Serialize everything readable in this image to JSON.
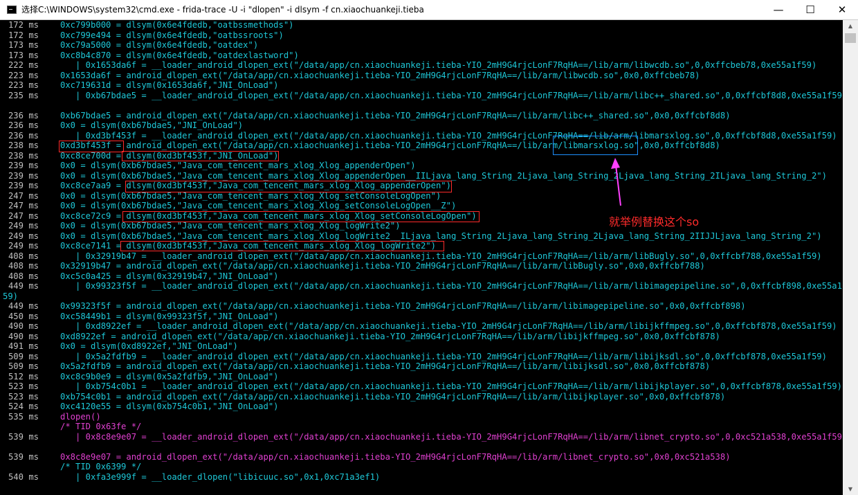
{
  "window": {
    "title": "选择C:\\WINDOWS\\system32\\cmd.exe - frida-trace  -U -i \"dlopen\" -i dlsym -f cn.xiaochuankeji.tieba",
    "minimize": "—",
    "maximize": "☐",
    "close": "✕"
  },
  "scrollbar": {
    "up": "▲",
    "down": "▼"
  },
  "annotation": {
    "text": "就举例替换这个so"
  },
  "lines": [
    {
      "t": "172 ms",
      "c": "0xc799b000 = dlsym(0x6e4fdedb,\"oatbssmethods\")",
      "color": "cyan"
    },
    {
      "t": "172 ms",
      "c": "0xc799e494 = dlsym(0x6e4fdedb,\"oatbssroots\")",
      "color": "cyan"
    },
    {
      "t": "173 ms",
      "c": "0xc79a5000 = dlsym(0x6e4fdedb,\"oatdex\")",
      "color": "cyan"
    },
    {
      "t": "173 ms",
      "c": "0xc8b4c870 = dlsym(0x6e4fdedb,\"oatdexlastword\")",
      "color": "cyan"
    },
    {
      "t": "222 ms",
      "c": "   | 0x1653da6f = __loader_android_dlopen_ext(\"/data/app/cn.xiaochuankeji.tieba-YIO_2mH9G4rjcLonF7RqHA==/lib/arm/libwcdb.so\",0,0xffcbeb78,0xe55a1f59)",
      "color": "cyan"
    },
    {
      "t": "223 ms",
      "c": "0x1653da6f = android_dlopen_ext(\"/data/app/cn.xiaochuankeji.tieba-YIO_2mH9G4rjcLonF7RqHA==/lib/arm/libwcdb.so\",0x0,0xffcbeb78)",
      "color": "cyan"
    },
    {
      "t": "223 ms",
      "c": "0xc719631d = dlsym(0x1653da6f,\"JNI_OnLoad\")",
      "color": "cyan"
    },
    {
      "t": "235 ms",
      "c": "   | 0xb67bdae5 = __loader_android_dlopen_ext(\"/data/app/cn.xiaochuankeji.tieba-YIO_2mH9G4rjcLonF7RqHA==/lib/arm/libc++_shared.so\",0,0xffcbf8d8,0xe55a1f59)",
      "color": "cyan"
    },
    {
      "t": "",
      "c": "",
      "color": "cyan"
    },
    {
      "t": "236 ms",
      "c": "0xb67bdae5 = android_dlopen_ext(\"/data/app/cn.xiaochuankeji.tieba-YIO_2mH9G4rjcLonF7RqHA==/lib/arm/libc++_shared.so\",0x0,0xffcbf8d8)",
      "color": "cyan"
    },
    {
      "t": "236 ms",
      "c": "0x0 = dlsym(0xb67bdae5,\"JNI_OnLoad\")",
      "color": "cyan"
    },
    {
      "t": "236 ms",
      "c": "   | 0xd3bf453f = __loader_android_dlopen_ext(\"/data/app/cn.xiaochuankeji.tieba-YIO_2mH9G4rjcLonF7RqHA==/lib/arm/libmarsxlog.so\",0,0xffcbf8d8,0xe55a1f59)",
      "color": "cyan"
    },
    {
      "t": "238 ms",
      "c": "0xd3bf453f = android_dlopen_ext(\"/data/app/cn.xiaochuankeji.tieba-YIO_2mH9G4rjcLonF7RqHA==/lib/arm/libmarsxlog.so\",0x0,0xffcbf8d8)",
      "color": "cyan"
    },
    {
      "t": "238 ms",
      "c": "0xc8ce700d = dlsym(0xd3bf453f,\"JNI_OnLoad\")",
      "color": "cyan"
    },
    {
      "t": "239 ms",
      "c": "0x0 = dlsym(0xb67bdae5,\"Java_com_tencent_mars_xlog_Xlog_appenderOpen\")",
      "color": "cyan"
    },
    {
      "t": "239 ms",
      "c": "0x0 = dlsym(0xb67bdae5,\"Java_com_tencent_mars_xlog_Xlog_appenderOpen__IILjava_lang_String_2Ljava_lang_String_2Ljava_lang_String_2ILjava_lang_String_2\")",
      "color": "cyan"
    },
    {
      "t": "239 ms",
      "c": "0xc8ce7aa9 = dlsym(0xd3bf453f,\"Java_com_tencent_mars_xlog_Xlog_appenderOpen\")",
      "color": "cyan"
    },
    {
      "t": "247 ms",
      "c": "0x0 = dlsym(0xb67bdae5,\"Java_com_tencent_mars_xlog_Xlog_setConsoleLogOpen\")",
      "color": "cyan"
    },
    {
      "t": "247 ms",
      "c": "0x0 = dlsym(0xb67bdae5,\"Java_com_tencent_mars_xlog_Xlog_setConsoleLogOpen__Z\")",
      "color": "cyan"
    },
    {
      "t": "247 ms",
      "c": "0xc8ce72c9 = dlsym(0xd3bf453f,\"Java_com_tencent_mars_xlog_Xlog_setConsoleLogOpen\")",
      "color": "cyan"
    },
    {
      "t": "249 ms",
      "c": "0x0 = dlsym(0xb67bdae5,\"Java_com_tencent_mars_xlog_Xlog_logWrite2\")",
      "color": "cyan"
    },
    {
      "t": "249 ms",
      "c": "0x0 = dlsym(0xb67bdae5,\"Java_com_tencent_mars_xlog_Xlog_logWrite2__ILjava_lang_String_2Ljava_lang_String_2Ljava_lang_String_2IIJJLjava_lang_String_2\")",
      "color": "cyan"
    },
    {
      "t": "249 ms",
      "c": "0xc8ce7141 = dlsym(0xd3bf453f,\"Java_com_tencent_mars_xlog_Xlog_logWrite2\")",
      "color": "cyan"
    },
    {
      "t": "408 ms",
      "c": "   | 0x32919b47 = __loader_android_dlopen_ext(\"/data/app/cn.xiaochuankeji.tieba-YIO_2mH9G4rjcLonF7RqHA==/lib/arm/libBugly.so\",0,0xffcbf788,0xe55a1f59)",
      "color": "cyan"
    },
    {
      "t": "408 ms",
      "c": "0x32919b47 = android_dlopen_ext(\"/data/app/cn.xiaochuankeji.tieba-YIO_2mH9G4rjcLonF7RqHA==/lib/arm/libBugly.so\",0x0,0xffcbf788)",
      "color": "cyan"
    },
    {
      "t": "408 ms",
      "c": "0xc5c0a425 = dlsym(0x32919b47,\"JNI_OnLoad\")",
      "color": "cyan"
    },
    {
      "t": "449 ms",
      "c": "   | 0x99323f5f = __loader_android_dlopen_ext(\"/data/app/cn.xiaochuankeji.tieba-YIO_2mH9G4rjcLonF7RqHA==/lib/arm/libimagepipeline.so\",0,0xffcbf898,0xe55a1f",
      "color": "cyan"
    },
    {
      "t": "59)",
      "c": "",
      "color": "cyan",
      "wrap": true
    },
    {
      "t": "449 ms",
      "c": "0x99323f5f = android_dlopen_ext(\"/data/app/cn.xiaochuankeji.tieba-YIO_2mH9G4rjcLonF7RqHA==/lib/arm/libimagepipeline.so\",0x0,0xffcbf898)",
      "color": "cyan"
    },
    {
      "t": "450 ms",
      "c": "0xc58449b1 = dlsym(0x99323f5f,\"JNI_OnLoad\")",
      "color": "cyan"
    },
    {
      "t": "490 ms",
      "c": "   | 0xd8922ef = __loader_android_dlopen_ext(\"/data/app/cn.xiaochuankeji.tieba-YIO_2mH9G4rjcLonF7RqHA==/lib/arm/libijkffmpeg.so\",0,0xffcbf878,0xe55a1f59)",
      "color": "cyan"
    },
    {
      "t": "490 ms",
      "c": "0xd8922ef = android_dlopen_ext(\"/data/app/cn.xiaochuankeji.tieba-YIO_2mH9G4rjcLonF7RqHA==/lib/arm/libijkffmpeg.so\",0x0,0xffcbf878)",
      "color": "cyan"
    },
    {
      "t": "491 ms",
      "c": "0x0 = dlsym(0xd8922ef,\"JNI_OnLoad\")",
      "color": "cyan"
    },
    {
      "t": "509 ms",
      "c": "   | 0x5a2fdfb9 = __loader_android_dlopen_ext(\"/data/app/cn.xiaochuankeji.tieba-YIO_2mH9G4rjcLonF7RqHA==/lib/arm/libijksdl.so\",0,0xffcbf878,0xe55a1f59)",
      "color": "cyan"
    },
    {
      "t": "509 ms",
      "c": "0x5a2fdfb9 = android_dlopen_ext(\"/data/app/cn.xiaochuankeji.tieba-YIO_2mH9G4rjcLonF7RqHA==/lib/arm/libijksdl.so\",0x0,0xffcbf878)",
      "color": "cyan"
    },
    {
      "t": "512 ms",
      "c": "0xc8c9b0e9 = dlsym(0x5a2fdfb9,\"JNI_OnLoad\")",
      "color": "cyan"
    },
    {
      "t": "523 ms",
      "c": "   | 0xb754c0b1 = __loader_android_dlopen_ext(\"/data/app/cn.xiaochuankeji.tieba-YIO_2mH9G4rjcLonF7RqHA==/lib/arm/libijkplayer.so\",0,0xffcbf878,0xe55a1f59)",
      "color": "cyan"
    },
    {
      "t": "523 ms",
      "c": "0xb754c0b1 = android_dlopen_ext(\"/data/app/cn.xiaochuankeji.tieba-YIO_2mH9G4rjcLonF7RqHA==/lib/arm/libijkplayer.so\",0x0,0xffcbf878)",
      "color": "cyan"
    },
    {
      "t": "524 ms",
      "c": "0xc4120e55 = dlsym(0xb754c0b1,\"JNI_OnLoad\")",
      "color": "cyan"
    },
    {
      "t": "535 ms",
      "c": "dlopen()",
      "color": "mag"
    },
    {
      "t": "",
      "c": "/* TID 0x63fe */",
      "color": "mag"
    },
    {
      "t": "539 ms",
      "c": "   | 0x8c8e9e07 = __loader_android_dlopen_ext(\"/data/app/cn.xiaochuankeji.tieba-YIO_2mH9G4rjcLonF7RqHA==/lib/arm/libnet_crypto.so\",0,0xc521a538,0xe55a1f59)",
      "color": "mag"
    },
    {
      "t": "",
      "c": "",
      "color": "mag"
    },
    {
      "t": "539 ms",
      "c": "0x8c8e9e07 = android_dlopen_ext(\"/data/app/cn.xiaochuankeji.tieba-YIO_2mH9G4rjcLonF7RqHA==/lib/arm/libnet_crypto.so\",0x0,0xc521a538)",
      "color": "mag"
    },
    {
      "t": "",
      "c": "/* TID 0x6399 */",
      "color": "cyan"
    },
    {
      "t": "540 ms",
      "c": "   | 0xfa3e999f = __loader_dlopen(\"libicuuc.so\",0x1,0xc71a3ef1)",
      "color": "cyan"
    }
  ]
}
